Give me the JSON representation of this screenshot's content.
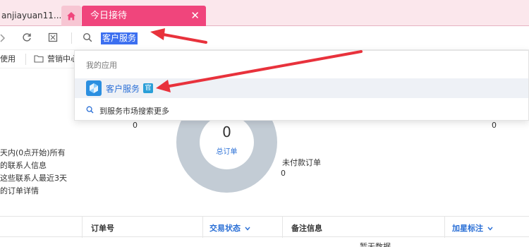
{
  "tabs": {
    "user_tab": "anjiayuan11...",
    "active_tab": "今日接待",
    "close_symbol": "✕"
  },
  "toolbar": {
    "search_value": "客户服务"
  },
  "bookmarks": {
    "item1": "使用",
    "item2": "营销中心"
  },
  "dropdown": {
    "header": "我的应用",
    "app_name": "客户服务",
    "official_badge": "官",
    "more_text": "到服务市场搜索更多"
  },
  "dashboard": {
    "left_count": "0",
    "right_count": "0",
    "description_lines": [
      "天内(0点开始)所有",
      "的联系人信息",
      "这些联系人最近3天",
      "的订单详情"
    ],
    "donut": {
      "value": "0",
      "label": "总订单",
      "ring_color": "#c3ccd5"
    },
    "unpaid": {
      "label": "未付款订单",
      "value": "0"
    }
  },
  "table": {
    "headers": [
      "订单号",
      "交易状态",
      "备注信息",
      "加星标注"
    ],
    "cut_text": "暂无数据"
  },
  "colors": {
    "accent": "#f0457c",
    "link": "#2a6fd6",
    "annotation_arrow": "#e8323c"
  }
}
